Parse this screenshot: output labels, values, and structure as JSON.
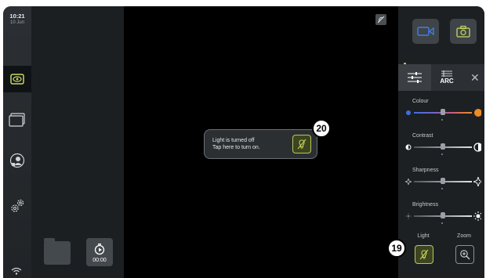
{
  "status": {
    "time": "10:21",
    "date": "10 Jun"
  },
  "recording": {
    "timer": "00:00"
  },
  "toast": {
    "line1": "Light is turned off",
    "line2": "Tap here to turn on."
  },
  "callouts": {
    "toast": "20",
    "light": "19"
  },
  "panel": {
    "tabs": [
      {
        "icon": "sliders-icon"
      },
      {
        "label": "ARC",
        "icon": "arc-icon"
      }
    ],
    "controls": [
      {
        "label": "Colour",
        "level": 0.5
      },
      {
        "label": "Contrast",
        "level": 0.5
      },
      {
        "label": "Sharpness",
        "level": 0.5
      },
      {
        "label": "Brightness",
        "level": 0.5
      }
    ],
    "light_label": "Light",
    "zoom_label": "Zoom"
  },
  "colors": {
    "accent": "#b7c95a",
    "colour_low": "#3f6ee0",
    "colour_high": "#f08a24",
    "camera_blue": "#3f7fe8"
  }
}
